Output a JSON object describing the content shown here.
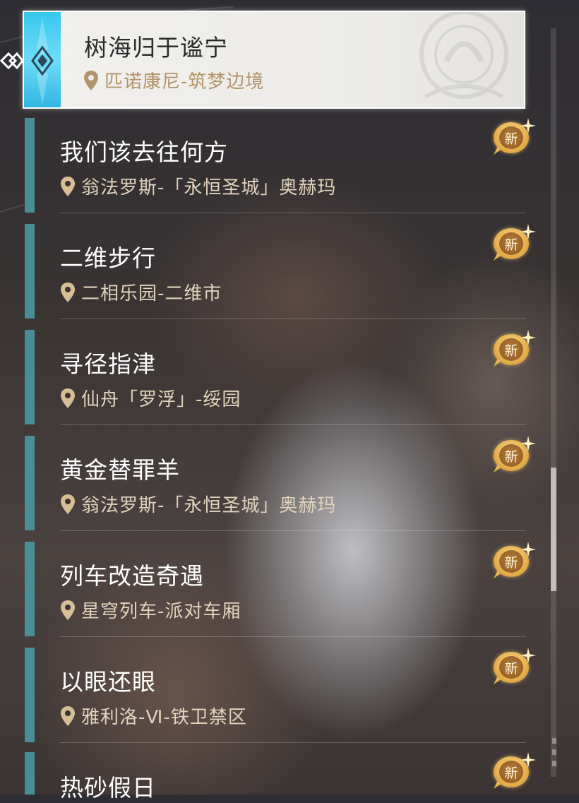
{
  "selected_mission": {
    "title": "树海归于谧宁",
    "location": "匹诺康尼-筑梦边境"
  },
  "missions": [
    {
      "title": "我们该去往何方",
      "location": "翁法罗斯-「永恒圣城」奥赫玛",
      "badge": "新"
    },
    {
      "title": "二维步行",
      "location": "二相乐园-二维市",
      "badge": "新"
    },
    {
      "title": "寻径指津",
      "location": "仙舟「罗浮」-绥园",
      "badge": "新"
    },
    {
      "title": "黄金替罪羊",
      "location": "翁法罗斯-「永恒圣城」奥赫玛",
      "badge": "新"
    },
    {
      "title": "列车改造奇遇",
      "location": "星穹列车-派对车厢",
      "badge": "新"
    },
    {
      "title": "以眼还眼",
      "location": "雅利洛-Ⅵ-铁卫禁区",
      "badge": "新"
    }
  ],
  "partial_mission": {
    "title": "热砂假日",
    "badge": "新"
  },
  "colors": {
    "accent_blue": "#36c7ee",
    "item_bar": "#4b8d96",
    "location_gold": "#b3946a",
    "badge_gold": "#e8b451"
  },
  "icons": {
    "pin": "map-pin-icon",
    "diamond": "diamond-icon",
    "badge": "new-badge-icon",
    "arrow": "double-chevron-icon"
  }
}
